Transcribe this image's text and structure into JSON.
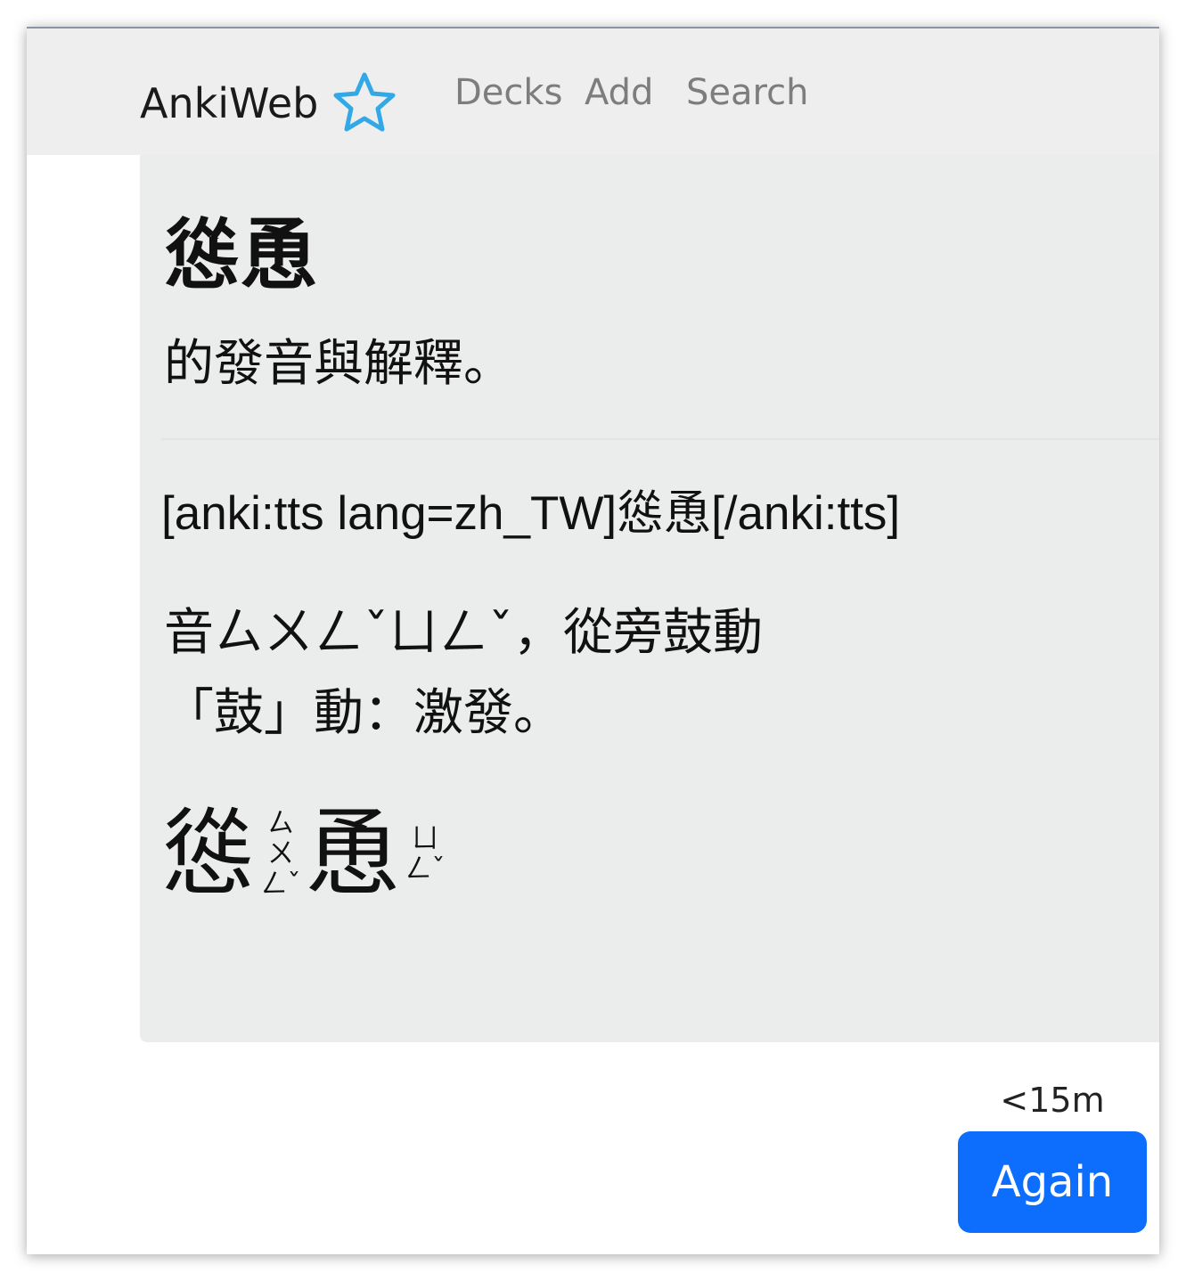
{
  "navbar": {
    "brand": "AnkiWeb",
    "links": [
      "Decks",
      "Add",
      "Search"
    ]
  },
  "card": {
    "word": "慫恿",
    "subtitle": "的發音與解釋。",
    "tts": "[anki:tts lang=zh_TW]慫恿[/anki:tts]",
    "explanation_line1": "音ㄙㄨㄥˇㄩㄥˇ，從旁鼓動",
    "explanation_line2": "「鼓」動：激發。",
    "ruby": [
      {
        "char": "慫",
        "zhuyin": [
          "ㄙ",
          "ㄨ",
          "ㄥˇ"
        ]
      },
      {
        "char": "恿",
        "zhuyin": [
          "ㄩ",
          "ㄥˇ"
        ]
      }
    ]
  },
  "answer": {
    "interval": "<15m",
    "again_label": "Again"
  },
  "colors": {
    "navbar_bg": "#eeeeee",
    "card_bg": "#ebecec",
    "brand_icon": "#32a8e6",
    "nav_link": "#7d7d7d",
    "again_button": "#0d6efd"
  }
}
